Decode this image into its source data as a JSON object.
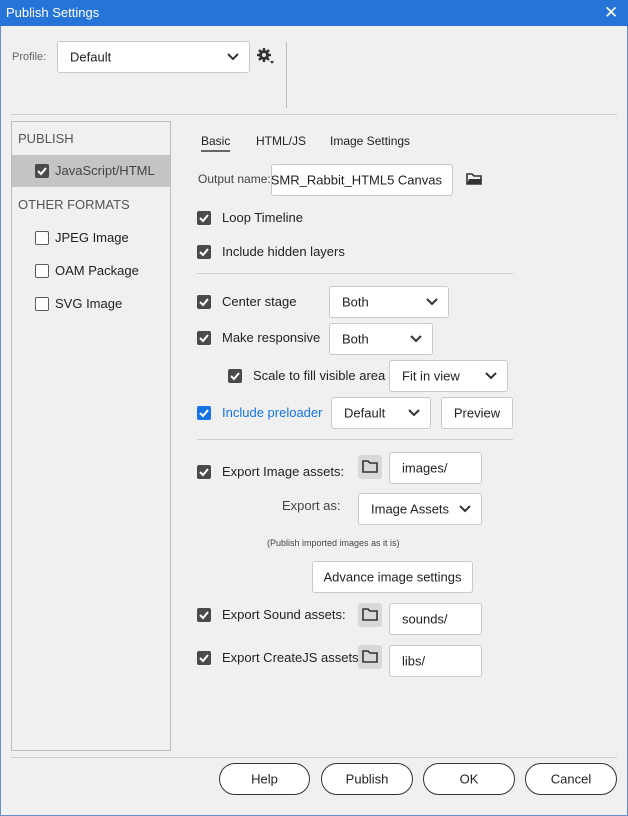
{
  "window": {
    "title": "Publish Settings",
    "close_icon": "close-icon"
  },
  "profile": {
    "label": "Profile:",
    "value": "Default"
  },
  "sidebar": {
    "publish_heading": "PUBLISH",
    "publish_items": [
      {
        "label": "JavaScript/HTML",
        "checked": true
      }
    ],
    "other_heading": "OTHER FORMATS",
    "other_items": [
      {
        "label": "JPEG Image",
        "checked": false
      },
      {
        "label": "OAM Package",
        "checked": false
      },
      {
        "label": "SVG Image",
        "checked": false
      }
    ]
  },
  "tabs": [
    {
      "label": "Basic",
      "active": true
    },
    {
      "label": "HTML/JS",
      "active": false
    },
    {
      "label": "Image Settings",
      "active": false
    }
  ],
  "basic": {
    "output_name_label": "Output name:",
    "output_name_value": "SMR_Rabbit_HTML5 Canvas",
    "loop_timeline": {
      "label": "Loop Timeline",
      "checked": true
    },
    "include_hidden_layers": {
      "label": "Include hidden layers",
      "checked": true
    },
    "center_stage": {
      "label": "Center stage",
      "checked": true,
      "value": "Both"
    },
    "make_responsive": {
      "label": "Make responsive",
      "checked": true,
      "value": "Both"
    },
    "scale_to_fill": {
      "label": "Scale to fill visible area",
      "checked": true,
      "value": "Fit in view"
    },
    "include_preloader": {
      "label": "Include preloader",
      "checked": true,
      "value": "Default",
      "preview_label": "Preview"
    },
    "export_image_assets": {
      "label": "Export Image assets:",
      "checked": true,
      "path": "images/"
    },
    "export_as": {
      "label": "Export as:",
      "value": "Image Assets"
    },
    "export_note": "(Publish imported images as it is)",
    "advance_image_settings_label": "Advance image settings",
    "export_sound_assets": {
      "label": "Export Sound assets:",
      "checked": true,
      "path": "sounds/"
    },
    "export_createjs_assets": {
      "label": "Export CreateJS assets:",
      "checked": true,
      "path": "libs/"
    }
  },
  "footer": {
    "help": "Help",
    "publish": "Publish",
    "ok": "OK",
    "cancel": "Cancel"
  },
  "colors": {
    "titlebar": "#2674d8",
    "accent_blue": "#1473e6",
    "dialog_bg": "#f0f0f0"
  }
}
